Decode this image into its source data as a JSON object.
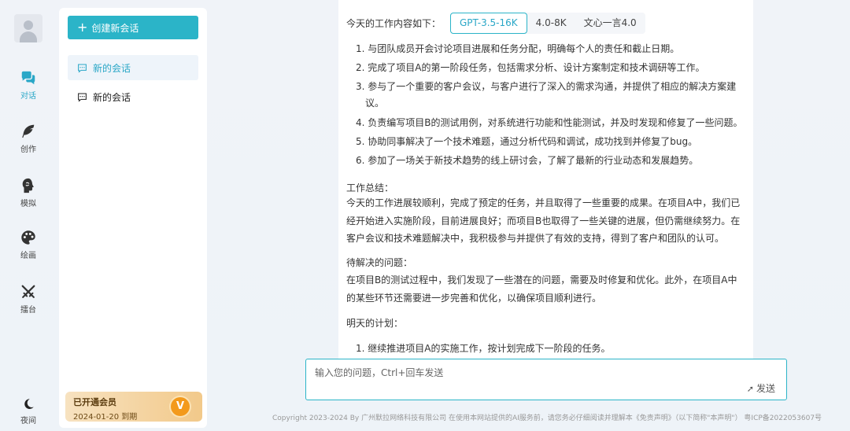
{
  "rail": {
    "items": [
      {
        "label": "对话",
        "icon": "chat-bubbles-icon",
        "active": true
      },
      {
        "label": "创作",
        "icon": "feather-icon",
        "active": false
      },
      {
        "label": "模拟",
        "icon": "head-profile-icon",
        "active": false
      },
      {
        "label": "绘画",
        "icon": "palette-icon",
        "active": false
      },
      {
        "label": "擂台",
        "icon": "crossed-swords-icon",
        "active": false
      }
    ],
    "night_label": "夜间"
  },
  "sidebar": {
    "new_chat_label": "创建新会话",
    "sessions": [
      {
        "label": "新的会话",
        "active": true
      },
      {
        "label": "新的会话",
        "active": false
      }
    ],
    "member": {
      "title": "已开通会员",
      "expiry": "2024-01-20 到期",
      "badge": "V"
    }
  },
  "models": {
    "tabs": [
      "GPT-3.5-16K",
      "4.0-8K",
      "文心一言4.0"
    ],
    "selected": "GPT-3.5-16K"
  },
  "message": {
    "intro": "今天的工作内容如下：",
    "items": [
      "1. 与团队成员开会讨论项目进展和任务分配，明确每个人的责任和截止日期。",
      "2. 完成了项目A的第一阶段任务，包括需求分析、设计方案制定和技术调研等工作。",
      "3. 参与了一个重要的客户会议，与客户进行了深入的需求沟通，并提供了相应的解决方案建",
      "议。",
      "4. 负责编写项目B的测试用例，对系统进行功能和性能测试，并及时发现和修复了一些问题。",
      "5. 协助同事解决了一个技术难题，通过分析代码和调试，成功找到并修复了bug。",
      "6. 参加了一场关于新技术趋势的线上研讨会，了解了最新的行业动态和发展趋势。"
    ],
    "summary_title": "工作总结：",
    "summary_lines": [
      "今天的工作进展较顺利，完成了预定的任务，并且取得了一些重要的成果。在项目A中，我们已",
      "经开始进入实施阶段，目前进展良好；而项目B也取得了一些关键的进展，但仍需继续努力。在",
      "客户会议和技术难题解决中，我积极参与并提供了有效的支持，得到了客户和团队的认可。"
    ],
    "issues_title": "待解决的问题：",
    "issues_lines": [
      "在项目B的测试过程中，我们发现了一些潜在的问题，需要及时修复和优化。此外，在项目A中",
      "的某些环节还需要进一步完善和优化，以确保项目顺利进行。"
    ],
    "plan_title": "明天的计划：",
    "plan_items": [
      "1. 继续推进项目A的实施工作，按计划完成下一阶段的任务。"
    ]
  },
  "input": {
    "placeholder": "输入您的问题，Ctrl+回车发送",
    "send_label": "发送"
  },
  "footer": {
    "text": "Copyright 2023-2024 By 广州默拉网络科技有限公司 在使用本网站提供的AI服务前，请您务必仔细阅读并理解本《免责声明》（以下简称\"本声明\"）  粤ICP备2022053607号"
  },
  "colors": {
    "accent": "#2bb4c8",
    "member_bg": "#f2c98a"
  }
}
